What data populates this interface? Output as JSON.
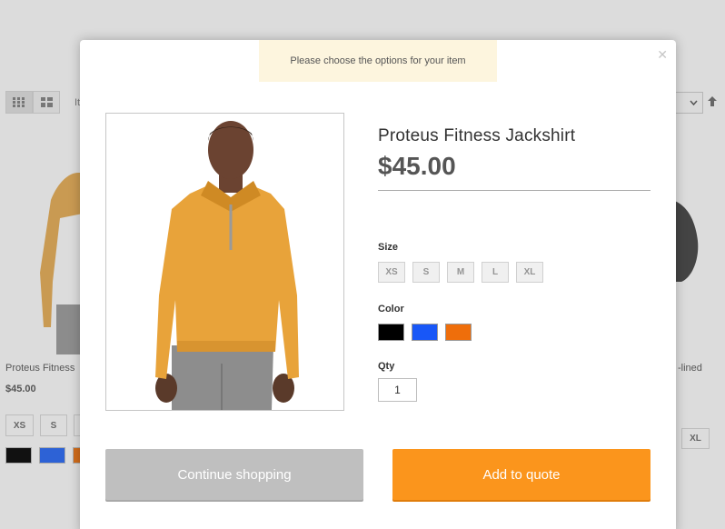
{
  "background": {
    "items_fragment": "It",
    "product_name": "Proteus Fitness",
    "product_price": "$45.00",
    "sizes": [
      "XS",
      "S"
    ],
    "swatches": [
      "#000000",
      "#1857f7",
      "#ef6e0b"
    ],
    "right_product_name": "-lined",
    "right_size": "XL"
  },
  "notice": "Please choose the options for your item",
  "product": {
    "name": "Proteus Fitness Jackshirt",
    "price": "$45.00"
  },
  "options": {
    "size_label": "Size",
    "sizes": [
      "XS",
      "S",
      "M",
      "L",
      "XL"
    ],
    "color_label": "Color",
    "colors": [
      "#000000",
      "#1857f7",
      "#ef6e0b"
    ],
    "qty_label": "Qty",
    "qty_value": "1"
  },
  "buttons": {
    "continue": "Continue shopping",
    "add_to_quote": "Add to quote"
  },
  "colors": {
    "accent": "#fb951c",
    "notice_bg": "#fdf5de",
    "secondary_button": "#bfbfbf"
  },
  "icons": {
    "close": "close-icon",
    "grid": "grid-view-icon",
    "list": "list-view-icon",
    "sort": "sort-arrow-icon"
  }
}
